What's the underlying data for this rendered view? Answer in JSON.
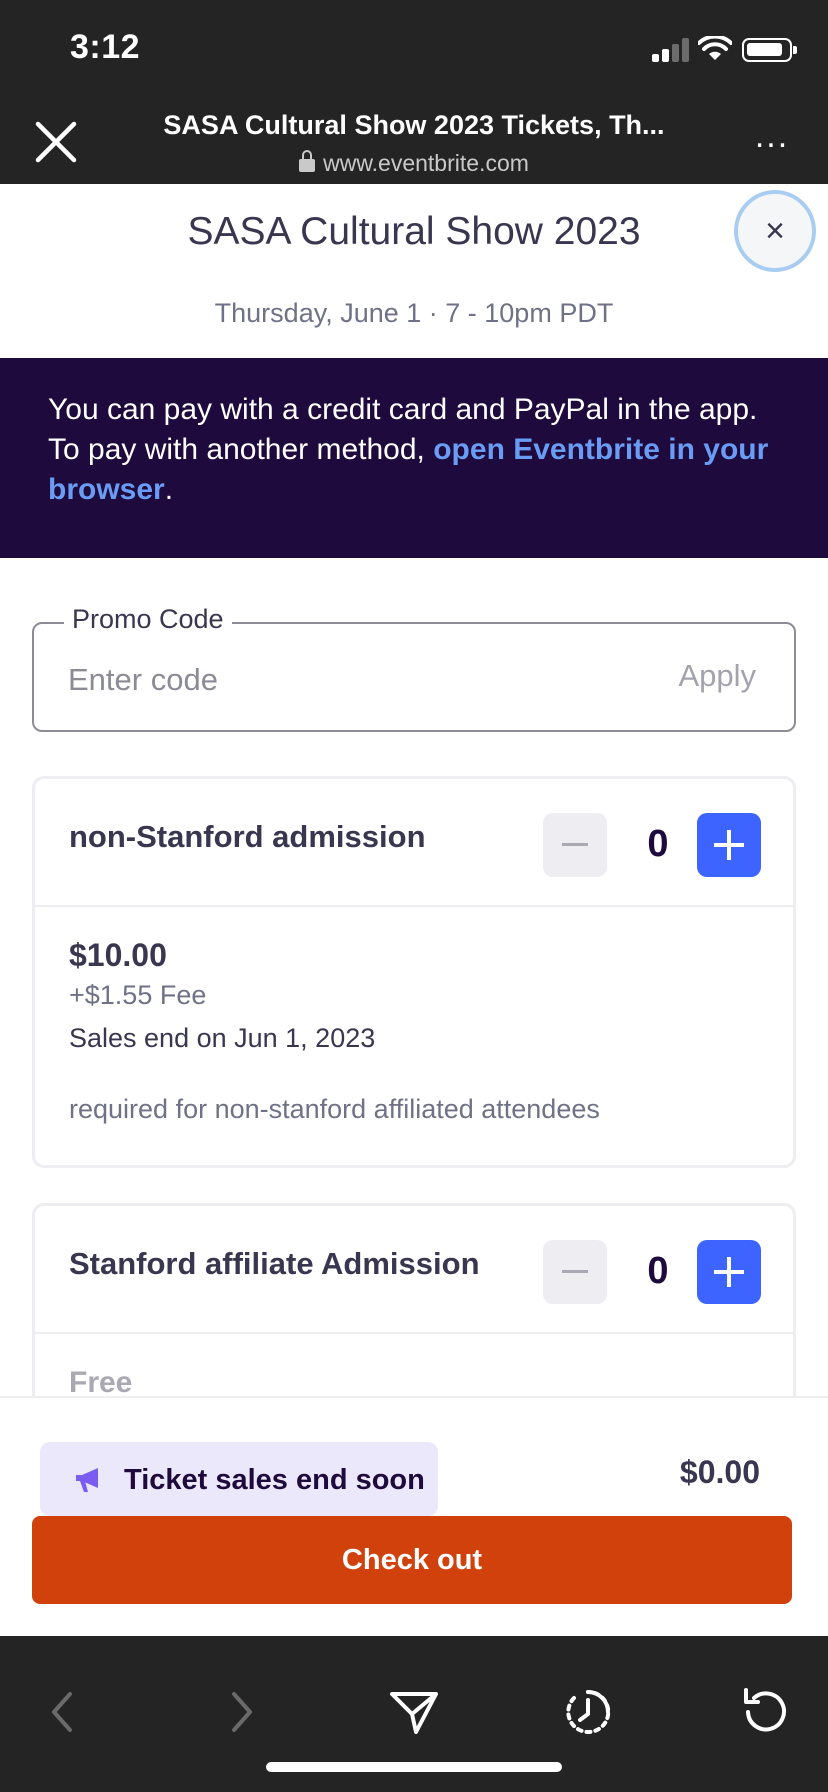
{
  "status_bar": {
    "time": "3:12"
  },
  "browser": {
    "title": "SASA Cultural Show 2023 Tickets, Th...",
    "url": "www.eventbrite.com",
    "more_label": "..."
  },
  "event": {
    "title": "SASA Cultural Show 2023",
    "date": "Thursday, June 1 · 7 - 10pm PDT",
    "close_label": "×"
  },
  "notice": {
    "text": "You can pay with a credit card and PayPal in the app. To pay with another method, ",
    "link": "open Eventbrite in your browser",
    "end": "."
  },
  "promo": {
    "legend": "Promo Code",
    "placeholder": "Enter code",
    "value": "",
    "apply_label": "Apply"
  },
  "tickets": [
    {
      "name": "non-Stanford admission",
      "quantity": "0",
      "price": "$10.00",
      "fee": "+$1.55 Fee",
      "sales_end": "Sales end on Jun 1, 2023",
      "description": "required for non-stanford affiliated attendees"
    },
    {
      "name": "Stanford affiliate Admission",
      "quantity": "0",
      "price": "Free"
    }
  ],
  "footer": {
    "urgency_label": "Ticket sales end soon",
    "total": "$0.00",
    "checkout_label": "Check out"
  },
  "colors": {
    "brand_dark": "#1e0a3c",
    "accent_blue": "#3d64ff",
    "checkout_orange": "#d1410c",
    "link_blue": "#6a9cf4"
  }
}
